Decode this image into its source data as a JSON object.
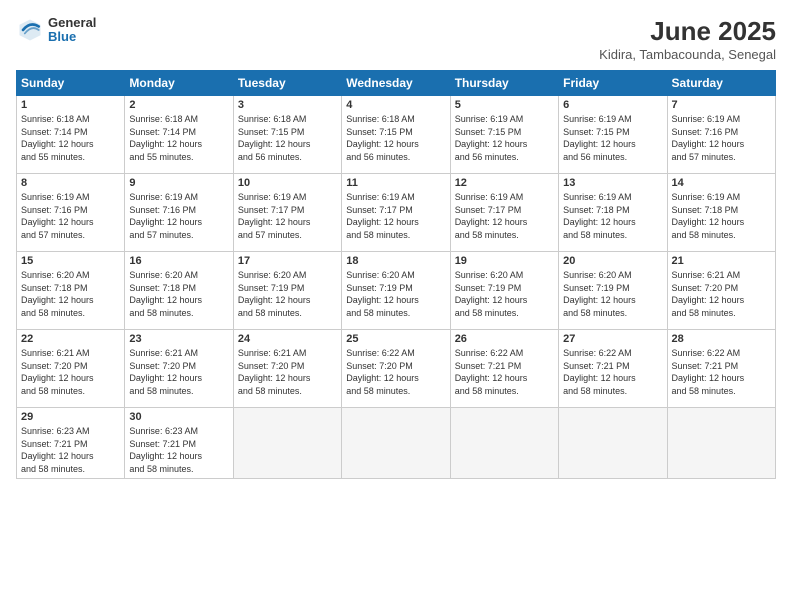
{
  "header": {
    "logo_general": "General",
    "logo_blue": "Blue",
    "title": "June 2025",
    "subtitle": "Kidira, Tambacounda, Senegal"
  },
  "weekdays": [
    "Sunday",
    "Monday",
    "Tuesday",
    "Wednesday",
    "Thursday",
    "Friday",
    "Saturday"
  ],
  "weeks": [
    [
      {
        "day": "1",
        "info": "Sunrise: 6:18 AM\nSunset: 7:14 PM\nDaylight: 12 hours\nand 55 minutes."
      },
      {
        "day": "2",
        "info": "Sunrise: 6:18 AM\nSunset: 7:14 PM\nDaylight: 12 hours\nand 55 minutes."
      },
      {
        "day": "3",
        "info": "Sunrise: 6:18 AM\nSunset: 7:15 PM\nDaylight: 12 hours\nand 56 minutes."
      },
      {
        "day": "4",
        "info": "Sunrise: 6:18 AM\nSunset: 7:15 PM\nDaylight: 12 hours\nand 56 minutes."
      },
      {
        "day": "5",
        "info": "Sunrise: 6:19 AM\nSunset: 7:15 PM\nDaylight: 12 hours\nand 56 minutes."
      },
      {
        "day": "6",
        "info": "Sunrise: 6:19 AM\nSunset: 7:15 PM\nDaylight: 12 hours\nand 56 minutes."
      },
      {
        "day": "7",
        "info": "Sunrise: 6:19 AM\nSunset: 7:16 PM\nDaylight: 12 hours\nand 57 minutes."
      }
    ],
    [
      {
        "day": "8",
        "info": "Sunrise: 6:19 AM\nSunset: 7:16 PM\nDaylight: 12 hours\nand 57 minutes."
      },
      {
        "day": "9",
        "info": "Sunrise: 6:19 AM\nSunset: 7:16 PM\nDaylight: 12 hours\nand 57 minutes."
      },
      {
        "day": "10",
        "info": "Sunrise: 6:19 AM\nSunset: 7:17 PM\nDaylight: 12 hours\nand 57 minutes."
      },
      {
        "day": "11",
        "info": "Sunrise: 6:19 AM\nSunset: 7:17 PM\nDaylight: 12 hours\nand 58 minutes."
      },
      {
        "day": "12",
        "info": "Sunrise: 6:19 AM\nSunset: 7:17 PM\nDaylight: 12 hours\nand 58 minutes."
      },
      {
        "day": "13",
        "info": "Sunrise: 6:19 AM\nSunset: 7:18 PM\nDaylight: 12 hours\nand 58 minutes."
      },
      {
        "day": "14",
        "info": "Sunrise: 6:19 AM\nSunset: 7:18 PM\nDaylight: 12 hours\nand 58 minutes."
      }
    ],
    [
      {
        "day": "15",
        "info": "Sunrise: 6:20 AM\nSunset: 7:18 PM\nDaylight: 12 hours\nand 58 minutes."
      },
      {
        "day": "16",
        "info": "Sunrise: 6:20 AM\nSunset: 7:18 PM\nDaylight: 12 hours\nand 58 minutes."
      },
      {
        "day": "17",
        "info": "Sunrise: 6:20 AM\nSunset: 7:19 PM\nDaylight: 12 hours\nand 58 minutes."
      },
      {
        "day": "18",
        "info": "Sunrise: 6:20 AM\nSunset: 7:19 PM\nDaylight: 12 hours\nand 58 minutes."
      },
      {
        "day": "19",
        "info": "Sunrise: 6:20 AM\nSunset: 7:19 PM\nDaylight: 12 hours\nand 58 minutes."
      },
      {
        "day": "20",
        "info": "Sunrise: 6:20 AM\nSunset: 7:19 PM\nDaylight: 12 hours\nand 58 minutes."
      },
      {
        "day": "21",
        "info": "Sunrise: 6:21 AM\nSunset: 7:20 PM\nDaylight: 12 hours\nand 58 minutes."
      }
    ],
    [
      {
        "day": "22",
        "info": "Sunrise: 6:21 AM\nSunset: 7:20 PM\nDaylight: 12 hours\nand 58 minutes."
      },
      {
        "day": "23",
        "info": "Sunrise: 6:21 AM\nSunset: 7:20 PM\nDaylight: 12 hours\nand 58 minutes."
      },
      {
        "day": "24",
        "info": "Sunrise: 6:21 AM\nSunset: 7:20 PM\nDaylight: 12 hours\nand 58 minutes."
      },
      {
        "day": "25",
        "info": "Sunrise: 6:22 AM\nSunset: 7:20 PM\nDaylight: 12 hours\nand 58 minutes."
      },
      {
        "day": "26",
        "info": "Sunrise: 6:22 AM\nSunset: 7:21 PM\nDaylight: 12 hours\nand 58 minutes."
      },
      {
        "day": "27",
        "info": "Sunrise: 6:22 AM\nSunset: 7:21 PM\nDaylight: 12 hours\nand 58 minutes."
      },
      {
        "day": "28",
        "info": "Sunrise: 6:22 AM\nSunset: 7:21 PM\nDaylight: 12 hours\nand 58 minutes."
      }
    ],
    [
      {
        "day": "29",
        "info": "Sunrise: 6:23 AM\nSunset: 7:21 PM\nDaylight: 12 hours\nand 58 minutes."
      },
      {
        "day": "30",
        "info": "Sunrise: 6:23 AM\nSunset: 7:21 PM\nDaylight: 12 hours\nand 58 minutes."
      },
      {
        "day": "",
        "info": ""
      },
      {
        "day": "",
        "info": ""
      },
      {
        "day": "",
        "info": ""
      },
      {
        "day": "",
        "info": ""
      },
      {
        "day": "",
        "info": ""
      }
    ]
  ]
}
